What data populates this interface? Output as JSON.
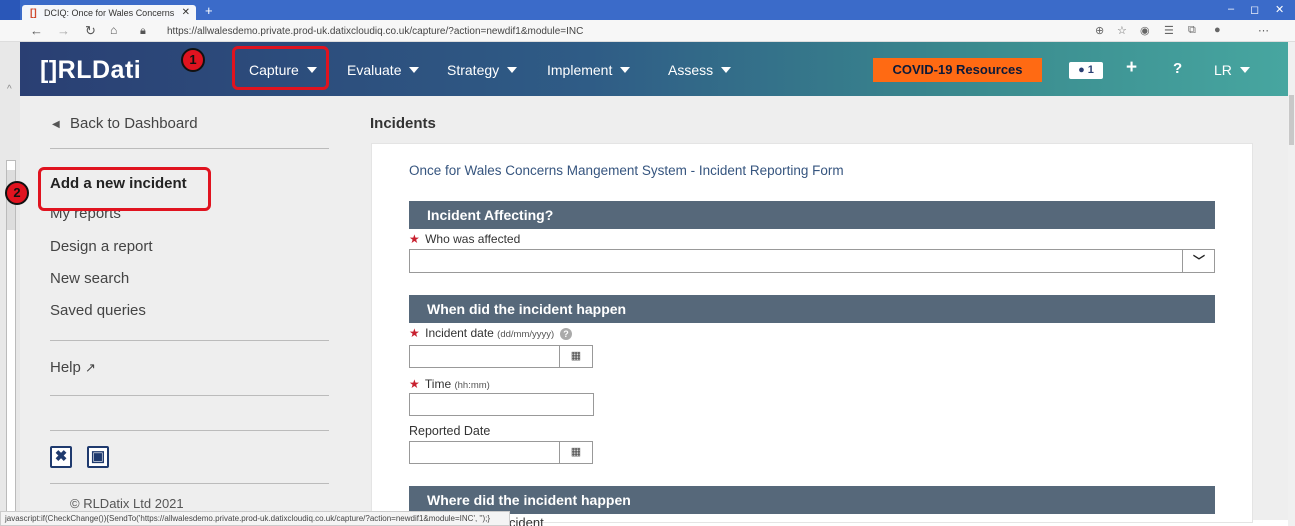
{
  "browser": {
    "tab_title": "DCIQ: Once for Wales Concerns",
    "tab_close": "✕",
    "new_tab": "+",
    "url": "https://allwalesdemo.private.prod-uk.datixcloudiq.co.uk/capture/?action=newdif1&module=INC",
    "minimize": "–",
    "maximize": "◻",
    "close": "✕",
    "status_text": "javascript:if(CheckChange()){SendTo('https://allwalesdemo.private.prod-uk.datixcloudiq.co.uk/capture/?action=newdif1&module=INC', '');}"
  },
  "app": {
    "logo_text": "RLDati",
    "nav": [
      "Capture",
      "Evaluate",
      "Strategy",
      "Implement",
      "Assess"
    ],
    "covid_button": "COVID-19 Resources",
    "user_count": "1",
    "user_initials": "LR"
  },
  "sidebar": {
    "back": "Back to Dashboard",
    "items": [
      "Add a new incident",
      "My reports",
      "Design a report",
      "New search",
      "Saved queries"
    ],
    "help": "Help",
    "copyright": "© RLDatix Ltd 2021"
  },
  "main": {
    "title": "Incidents",
    "form_title": "Once for Wales Concerns Mangement System  - Incident Reporting Form",
    "sections": [
      "Incident Affecting?",
      "When did the incident happen",
      "Where did the incident happen"
    ],
    "fields": {
      "who_affected": "Who was affected",
      "incident_date": "Incident date",
      "incident_date_format": "(dd/mm/yyyy)",
      "time": "Time",
      "time_format": "(hh:mm)",
      "reported_date": "Reported Date"
    },
    "peek_text": "cident"
  },
  "annotations": [
    "1",
    "2"
  ],
  "colors": {
    "accent_red": "#e0131f",
    "covid_orange": "#ff6a13",
    "section_header": "#56687a",
    "nav_dark": "#2a3f73"
  }
}
